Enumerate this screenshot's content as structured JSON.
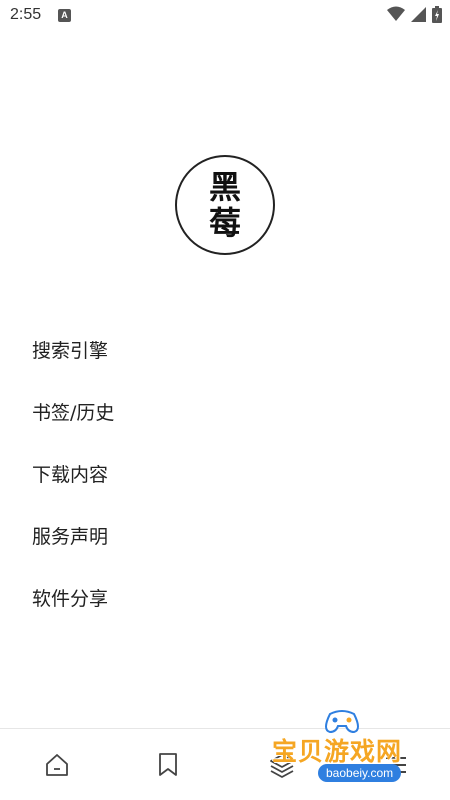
{
  "status_bar": {
    "time": "2:55",
    "notification_badge": "A",
    "icons": [
      "wifi-icon",
      "signal-icon",
      "battery-icon"
    ]
  },
  "logo": {
    "line1": "黑",
    "line2": "莓"
  },
  "menu": {
    "items": [
      {
        "label": "搜索引擎"
      },
      {
        "label": "书签/历史"
      },
      {
        "label": "下载内容"
      },
      {
        "label": "服务声明"
      },
      {
        "label": "软件分享"
      }
    ]
  },
  "bottom_nav": {
    "icons": [
      "home-icon",
      "bookmark-icon",
      "layers-icon",
      "menu-icon"
    ]
  },
  "watermark": {
    "text": "宝贝游戏网",
    "url": "baobeiy.com"
  },
  "colors": {
    "watermark_orange": "#f5a623",
    "watermark_blue": "#2f7fe0"
  }
}
